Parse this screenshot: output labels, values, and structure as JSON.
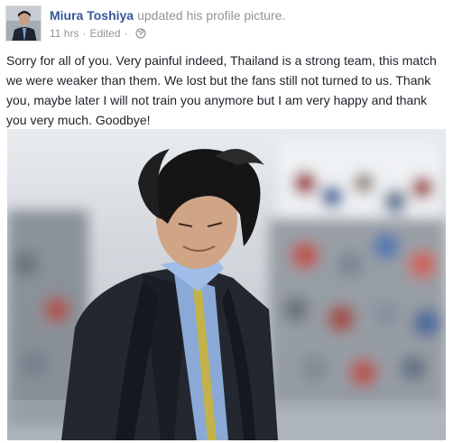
{
  "post": {
    "author_name": "Miura Toshiya",
    "action_text": "updated his profile picture.",
    "timestamp": "11 hrs",
    "separator": "·",
    "edited_label": "Edited",
    "audience_icon": "globe-icon",
    "message": "Sorry for all of you. Very painful indeed, Thailand is a strong team, this match we were weaker than them. We lost but the fans still not turned to us. Thank you, maybe later I will not train you anymore but I am very happy and thank you very much. Goodbye!"
  },
  "colors": {
    "author_link": "#365899",
    "meta_gray": "#90949c",
    "text": "#1d2129"
  }
}
